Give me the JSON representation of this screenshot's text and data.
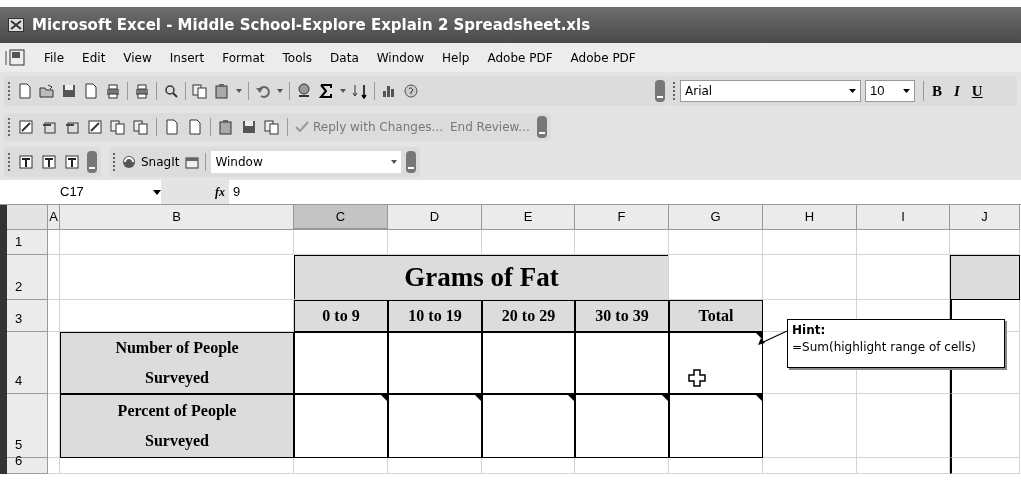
{
  "window": {
    "title": "Microsoft Excel - Middle School-Explore Explain 2 Spreadsheet.xls"
  },
  "menu": [
    "File",
    "Edit",
    "View",
    "Insert",
    "Format",
    "Tools",
    "Data",
    "Window",
    "Help",
    "Adobe PDF",
    "Adobe PDF"
  ],
  "formatting": {
    "font": "Arial",
    "size": "10",
    "style_buttons": [
      "B",
      "I",
      "U"
    ]
  },
  "review_toolbar": [
    "Reply with Changes...",
    "End Review..."
  ],
  "snagit_toolbar": {
    "label": "SnagIt",
    "dropdown": "Window"
  },
  "formula_bar": {
    "name_box": "C17",
    "function_label": "fx",
    "value": "9"
  },
  "sheet": {
    "columns": [
      {
        "label": "A",
        "selected": false
      },
      {
        "label": "B",
        "selected": false
      },
      {
        "label": "C",
        "selected": true
      },
      {
        "label": "D",
        "selected": false
      },
      {
        "label": "E",
        "selected": false
      },
      {
        "label": "F",
        "selected": false
      },
      {
        "label": "G",
        "selected": false
      },
      {
        "label": "H",
        "selected": false
      },
      {
        "label": "I",
        "selected": false
      },
      {
        "label": "J",
        "selected": false
      }
    ],
    "rows": [
      {
        "label": "1",
        "cells": [
          {
            "kind": "blank"
          },
          {
            "kind": "blank"
          },
          {
            "kind": "blank"
          },
          {
            "kind": "blank"
          },
          {
            "kind": "blank"
          },
          {
            "kind": "blank"
          },
          {
            "kind": "blank"
          },
          {
            "kind": "blank"
          },
          {
            "kind": "blank"
          },
          {
            "kind": "blank"
          }
        ]
      },
      {
        "label": "2",
        "banner": {
          "text": "Grams of Fat"
        },
        "cells": [
          {
            "kind": "blank"
          },
          {
            "kind": "blank"
          },
          {
            "kind": "merged"
          },
          {
            "kind": "merged"
          },
          {
            "kind": "merged"
          },
          {
            "kind": "merged"
          },
          {
            "kind": "blank"
          },
          {
            "kind": "blank"
          },
          {
            "kind": "blank"
          },
          {
            "kind": "shaded"
          }
        ]
      },
      {
        "label": "3",
        "cells": [
          {
            "kind": "blank"
          },
          {
            "kind": "blank"
          },
          {
            "kind": "heading",
            "text": "0 to 9"
          },
          {
            "kind": "heading",
            "text": "10 to 19"
          },
          {
            "kind": "heading",
            "text": "20 to 29"
          },
          {
            "kind": "heading",
            "text": "30 to 39"
          },
          {
            "kind": "heading",
            "text": "Total"
          },
          {
            "kind": "blank"
          },
          {
            "kind": "blank"
          },
          {
            "kind": "edge"
          }
        ]
      },
      {
        "label": "4",
        "cells": [
          {
            "kind": "blank"
          },
          {
            "kind": "label",
            "text": "Number of People Surveyed"
          },
          {
            "kind": "entry",
            "comment": false
          },
          {
            "kind": "entry",
            "comment": false
          },
          {
            "kind": "entry",
            "comment": false
          },
          {
            "kind": "entry",
            "comment": false
          },
          {
            "kind": "entry",
            "comment": true
          },
          {
            "kind": "blank"
          },
          {
            "kind": "blank"
          },
          {
            "kind": "edge"
          }
        ]
      },
      {
        "label": "5",
        "cells": [
          {
            "kind": "blank"
          },
          {
            "kind": "label",
            "text": "Percent of People Surveyed"
          },
          {
            "kind": "entry",
            "comment": true
          },
          {
            "kind": "entry",
            "comment": true
          },
          {
            "kind": "entry",
            "comment": true
          },
          {
            "kind": "entry",
            "comment": true
          },
          {
            "kind": "entry",
            "comment": true
          },
          {
            "kind": "blank"
          },
          {
            "kind": "blank"
          },
          {
            "kind": "edge"
          }
        ]
      },
      {
        "label": "6",
        "cells": [
          {
            "kind": "blank"
          },
          {
            "kind": "blank"
          },
          {
            "kind": "blank"
          },
          {
            "kind": "blank"
          },
          {
            "kind": "blank"
          },
          {
            "kind": "blank"
          },
          {
            "kind": "blank"
          },
          {
            "kind": "blank"
          },
          {
            "kind": "blank"
          },
          {
            "kind": "edge"
          }
        ]
      }
    ]
  },
  "comment": {
    "title": "Hint:",
    "text": "=Sum(highlight range of cells)"
  }
}
